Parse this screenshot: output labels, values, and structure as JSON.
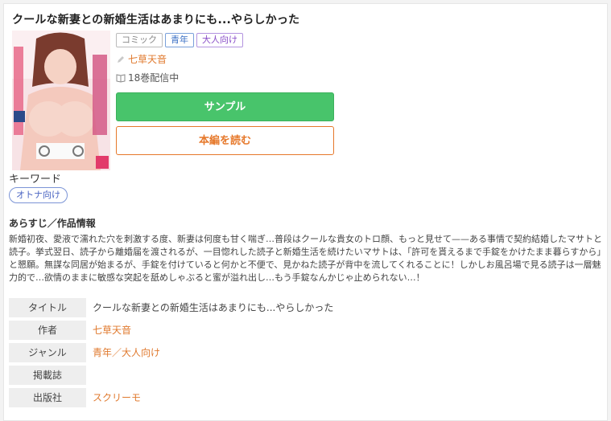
{
  "title": "クールな新妻との新婚生活はあまりにも...やらしかった",
  "tags": [
    {
      "label": "コミック",
      "style": "gray"
    },
    {
      "label": "青年",
      "style": "blue"
    },
    {
      "label": "大人向け",
      "style": "purple"
    }
  ],
  "author": {
    "icon": "pen-icon",
    "name": "七草天音"
  },
  "volumes": {
    "icon": "book-icon",
    "text": "18巻配信中"
  },
  "buttons": {
    "sample": "サンプル",
    "read": "本編を読む"
  },
  "keywords": {
    "title": "キーワード",
    "items": [
      "オトナ向け"
    ]
  },
  "synopsis": {
    "title": "あらすじ／作品情報",
    "text": "新婚初夜、愛液で濡れた穴を刺激する度、新妻は何度も甘く喘ぎ…普段はクールな貴女のトロ顔、もっと見せて——ある事情で契約結婚したマサトと読子。挙式翌日、読子から離婚届を渡されるが、一目惚れした読子と新婚生活を続けたいマサトは、「許可を貰えるまで手錠をかけたまま暮らすから」と懇願。無謀な同居が始まるが、手錠を付けていると何かと不便で、見かねた読子が背中を流してくれることに！しかしお風呂場で見る読子は一層魅力的で…欲情のままに敏感な突起を舐めしゃぶると蜜が溢れ出し…もう手錠なんかじゃ止められない…！"
  },
  "info": [
    {
      "label": "タイトル",
      "value": "クールな新妻との新婚生活はあまりにも...やらしかった",
      "link": false
    },
    {
      "label": "作者",
      "value": "七草天音",
      "link": true
    },
    {
      "label": "ジャンル",
      "value": "青年／大人向け",
      "link": true
    },
    {
      "label": "掲載誌",
      "value": "",
      "link": false
    },
    {
      "label": "出版社",
      "value": "スクリーモ",
      "link": true
    }
  ],
  "colors": {
    "accent": "#e07a2f",
    "sample_button": "#48c46b",
    "keyword_chip": "#4a64c2"
  }
}
